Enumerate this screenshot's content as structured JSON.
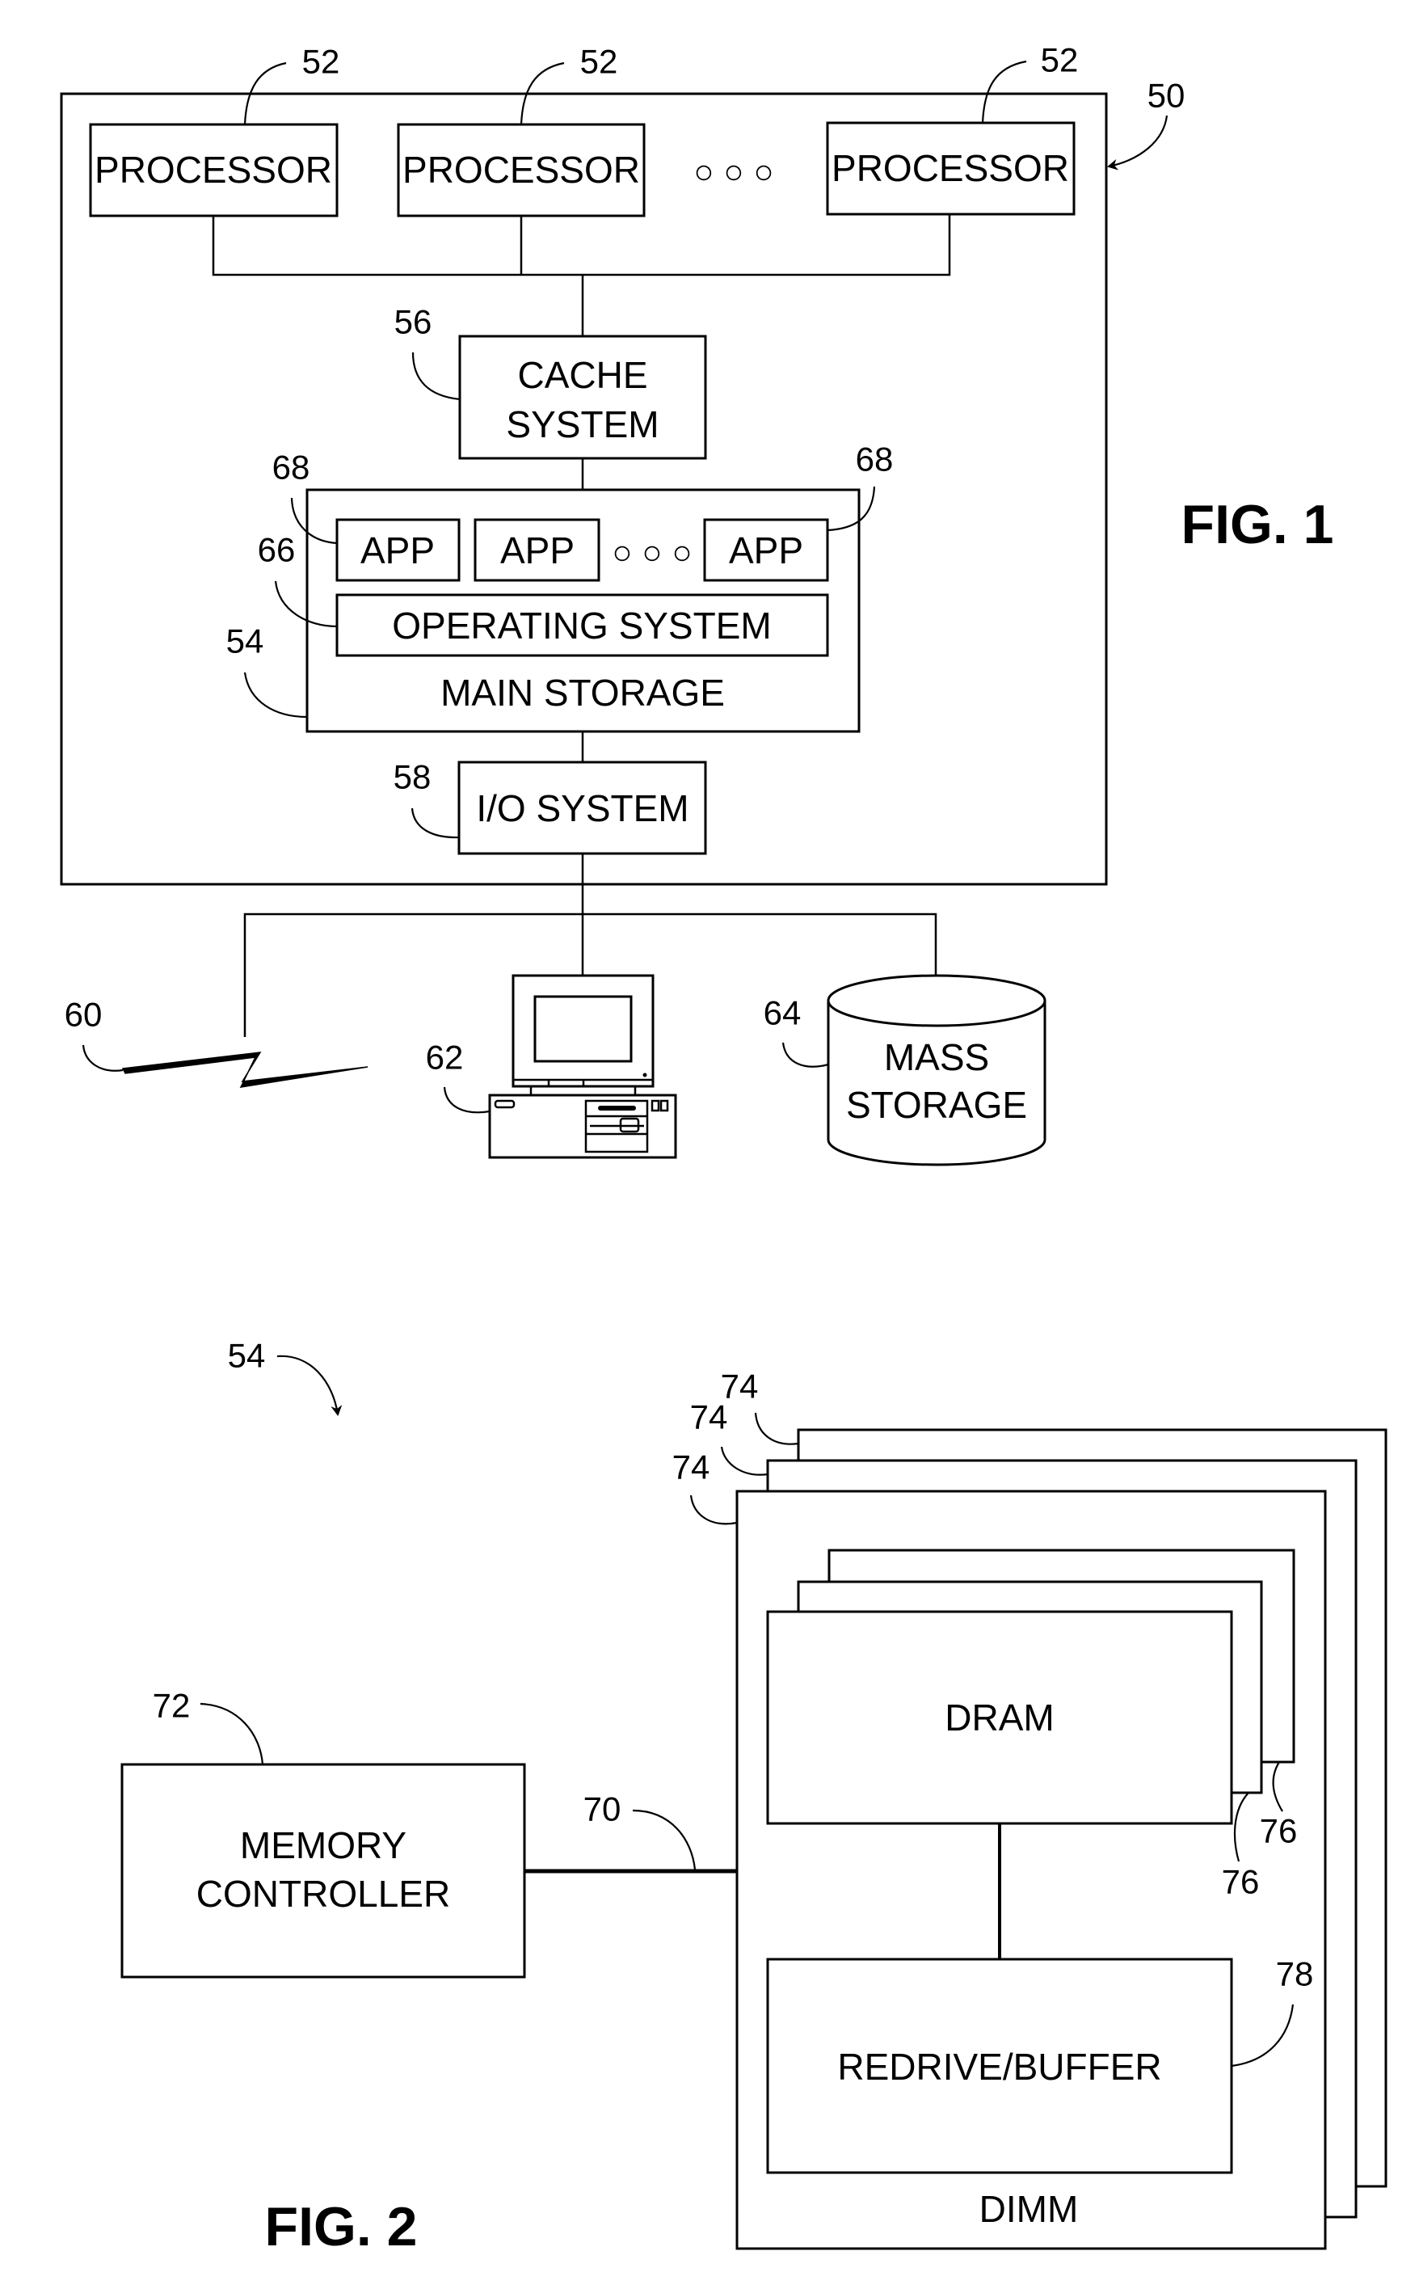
{
  "fig1": {
    "caption": "FIG. 1",
    "system_ref": "50",
    "processors": [
      {
        "label": "PROCESSOR",
        "ref": "52"
      },
      {
        "label": "PROCESSOR",
        "ref": "52"
      },
      {
        "label": "PROCESSOR",
        "ref": "52"
      }
    ],
    "ellipsis": "○ ○ ○",
    "cache": {
      "line1": "CACHE",
      "line2": "SYSTEM",
      "ref": "56"
    },
    "main_storage": {
      "label": "MAIN STORAGE",
      "ref": "54",
      "apps": [
        {
          "label": "APP",
          "ref": "68"
        },
        {
          "label": "APP"
        },
        {
          "label": "APP",
          "ref": "68"
        }
      ],
      "operating_system": {
        "label": "OPERATING SYSTEM",
        "ref": "66"
      }
    },
    "io_system": {
      "label": "I/O SYSTEM",
      "ref": "58"
    },
    "network": {
      "ref": "60"
    },
    "workstation": {
      "ref": "62"
    },
    "mass_storage": {
      "line1": "MASS",
      "line2": "STORAGE",
      "ref": "64"
    }
  },
  "fig2": {
    "caption": "FIG. 2",
    "memory_ref": "54",
    "memory_controller": {
      "line1": "MEMORY",
      "line2": "CONTROLLER",
      "ref": "72"
    },
    "bus": {
      "ref": "70"
    },
    "dimm": {
      "label": "DIMM",
      "refs": [
        "74",
        "74",
        "74"
      ]
    },
    "dram": {
      "label": "DRAM",
      "refs": [
        "76",
        "76"
      ]
    },
    "redrive_buffer": {
      "label": "REDRIVE/BUFFER",
      "ref": "78"
    }
  }
}
